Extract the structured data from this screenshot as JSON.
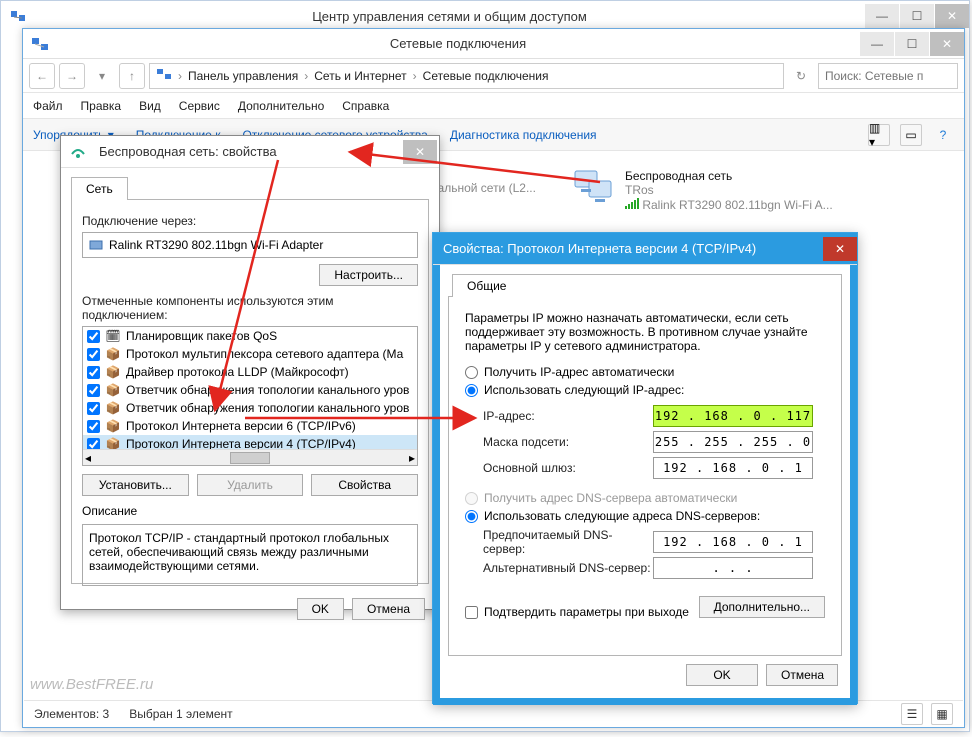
{
  "center": {
    "title": "Центр управления сетями и общим доступом"
  },
  "conn": {
    "title": "Сетевые подключения",
    "breadcrumb": [
      "Панель управления",
      "Сеть и Интернет",
      "Сетевые подключения"
    ],
    "search_placeholder": "Поиск: Сетевые п",
    "menu": [
      "Файл",
      "Правка",
      "Вид",
      "Сервис",
      "Дополнительно",
      "Справка"
    ],
    "toolbar": {
      "organize": "Упорядочить ▾",
      "connect": "Подключение к",
      "disable": "Отключение сетевого устройства",
      "diag": "Диагностика подключения"
    },
    "adapter": {
      "name": "Беспроводная сеть",
      "net": "TRos",
      "device": "Ralink RT3290 802.11bgn Wi-Fi A..."
    },
    "global_label": "глобальной сети (L2...",
    "status": {
      "count": "Элементов: 3",
      "selected": "Выбран 1 элемент"
    }
  },
  "props": {
    "title": "Беспроводная сеть: свойства",
    "tab": "Сеть",
    "connect_via": "Подключение через:",
    "adapter": "Ralink RT3290 802.11bgn Wi-Fi Adapter",
    "configure": "Настроить...",
    "components_label": "Отмеченные компоненты используются этим подключением:",
    "components": [
      "Планировщик пакетов QoS",
      "Протокол мультиплексора сетевого адаптера (Ма",
      "Драйвер протокола LLDP (Майкрософт)",
      "Ответчик обнаружения топологии канального уров",
      "Ответчик обнаружения топологии канального уров",
      "Протокол Интернета версии 6 (TCP/IPv6)",
      "Протокол Интернета версии 4 (TCP/IPv4)"
    ],
    "install": "Установить...",
    "remove": "Удалить",
    "properties": "Свойства",
    "desc_label": "Описание",
    "desc": "Протокол TCP/IP - стандартный протокол глобальных сетей, обеспечивающий связь между различными взаимодействующими сетями.",
    "ok": "OK",
    "cancel": "Отмена"
  },
  "ipv4": {
    "title": "Свойства: Протокол Интернета версии 4 (TCP/IPv4)",
    "tab": "Общие",
    "intro": "Параметры IP можно назначать автоматически, если сеть поддерживает эту возможность. В противном случае узнайте параметры IP у сетевого администратора.",
    "r_auto_ip": "Получить IP-адрес автоматически",
    "r_static_ip": "Использовать следующий IP-адрес:",
    "ip_label": "IP-адрес:",
    "ip": "192 . 168 .  0  . 117",
    "mask_label": "Маска подсети:",
    "mask": "255 . 255 . 255 .  0",
    "gw_label": "Основной шлюз:",
    "gw": "192 . 168 .  0  .  1",
    "r_auto_dns": "Получить адрес DNS-сервера автоматически",
    "r_static_dns": "Использовать следующие адреса DNS-серверов:",
    "dns1_label": "Предпочитаемый DNS-сервер:",
    "dns1": "192 . 168 .  0  .  1",
    "dns2_label": "Альтернативный DNS-сервер:",
    "dns2": " .       .       .",
    "confirm_exit": "Подтвердить параметры при выходе",
    "advanced": "Дополнительно...",
    "ok": "OK",
    "cancel": "Отмена"
  },
  "watermark": "www.BestFREE.ru"
}
